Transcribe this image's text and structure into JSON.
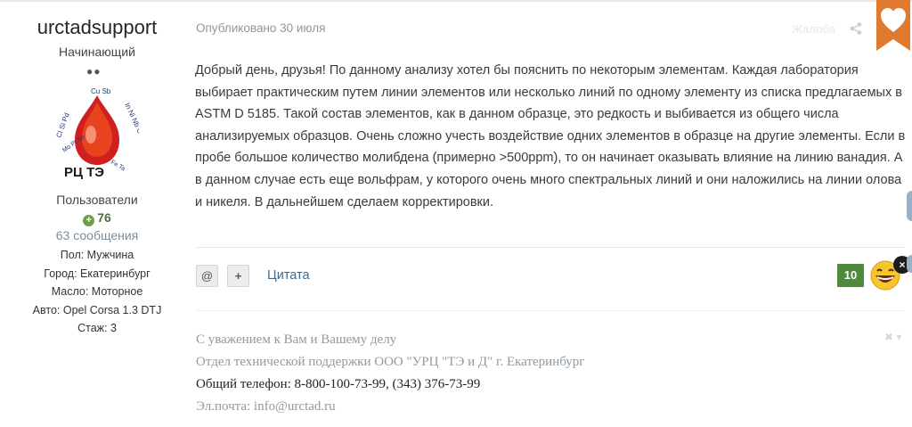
{
  "author": {
    "name": "urctadsupport",
    "rank": "Начинающий",
    "rank_dots": "●●",
    "group": "Пользователи",
    "reputation": "76",
    "messages": "63 сообщения",
    "avatar_logo_text": "РЦ ТЭ",
    "fields": [
      "Пол: Мужчина",
      "Город: Екатеринбург",
      "Масло: Моторное",
      "Авто: Opel Corsa 1.3 DTJ",
      "Стаж: 3"
    ]
  },
  "post": {
    "meta": "Опубликовано 30 июля",
    "report_label": "Жалоба",
    "body": "Добрый день, друзья! По данному анализу хотел бы пояснить по некоторым элементам. Каждая лаборатория выбирает практическим путем линии элементов или несколько линий по одному элементу из списка предлагаемых в ASTM D 5185. Такой состав элементов, как в данном образце, это редкость и выбивается из общего числа анализируемых образцов. Очень сложно учесть воздействие одних элементов в образце на другие элементы. Если в пробе большое количество молибдена (примерно >500ppm), то он начинает оказывать влияние на линию ванадия. А в данном случае есть еще вольфрам, у которого очень много спектральных линий и они наложились на линии олова и никеля. В дальнейшем сделаем корректировки."
  },
  "actions": {
    "mention_label": "@",
    "plus_label": "+",
    "quote_label": "Цитата",
    "reputation_count": "10",
    "close_label": "×"
  },
  "signature": {
    "lines": [
      "С уважением к Вам и Вашему делу",
      "Отдел технической поддержки ООО \"УРЦ \"ТЭ и Д\" г. Екатеринбург",
      "Общий телефон: 8-800-100-73-99, (343) 376-73-99",
      "Эл.почта: info@urctad.ru"
    ]
  },
  "colors": {
    "accent_orange": "#e07a2f",
    "reputation_green": "#4f8a3c",
    "link_blue": "#3d6a8b"
  },
  "icons": [
    "share-icon",
    "heart-icon",
    "plus-circle-icon",
    "close-icon",
    "grin-emoji-icon",
    "chevron-down-icon"
  ]
}
